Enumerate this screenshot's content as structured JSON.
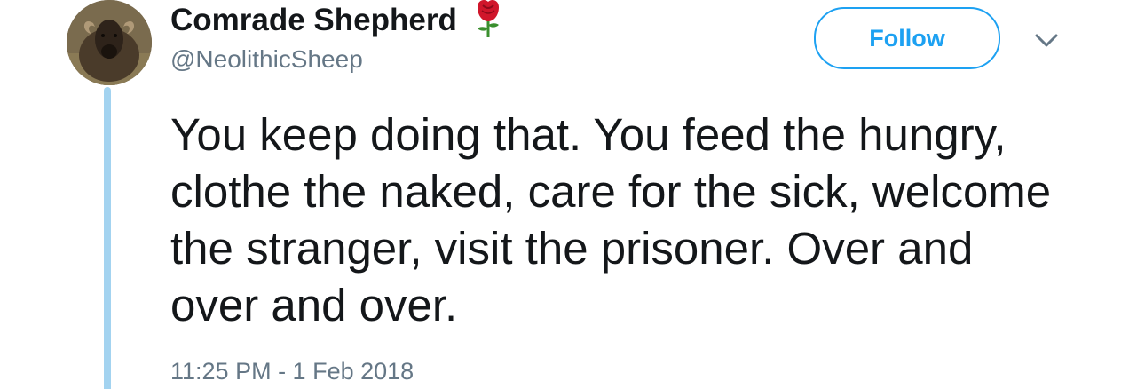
{
  "author": {
    "display_name": "Comrade Shepherd",
    "name_emoji": "rose",
    "handle": "@NeolithicSheep",
    "avatar_subject": "sheep"
  },
  "header": {
    "follow_label": "Follow",
    "menu_icon": "chevron-down-icon"
  },
  "tweet": {
    "text": "You keep doing that. You feed the hungry, clothe the naked, care for the sick, welcome the stranger, visit the prisoner. Over and over and over.",
    "timestamp": "11:25 PM - 1 Feb 2018"
  },
  "colors": {
    "accent": "#1da1f2",
    "thread_line": "#a3d3f0",
    "text": "#14171a",
    "muted": "#657786"
  }
}
